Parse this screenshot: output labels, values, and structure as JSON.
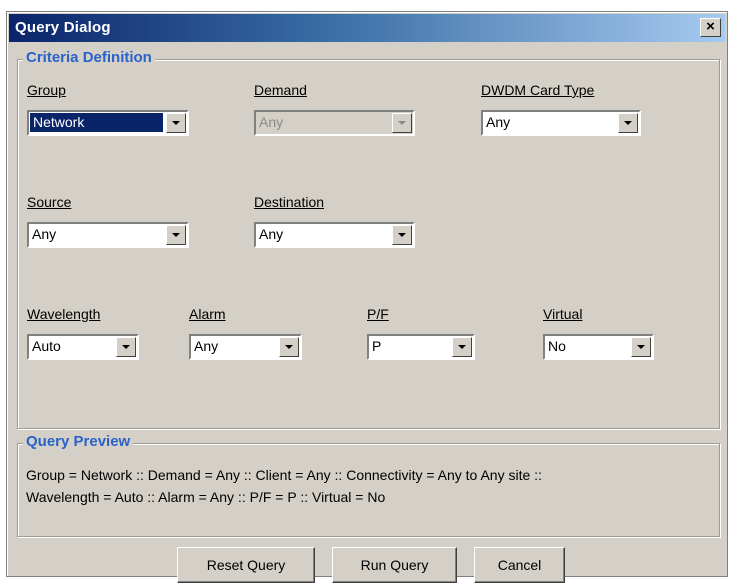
{
  "window": {
    "title": "Query Dialog",
    "close_glyph": "×",
    "close_icon": "close-icon"
  },
  "criteria": {
    "legend": "Criteria Definition",
    "group": {
      "label": "Group",
      "value": "Network"
    },
    "demand": {
      "label": "Demand",
      "value": "Any"
    },
    "dwdm": {
      "label": "DWDM Card Type",
      "value": "Any"
    },
    "source": {
      "label": "Source",
      "value": "Any"
    },
    "destination": {
      "label": "Destination",
      "value": "Any"
    },
    "wavelength": {
      "label": "Wavelength",
      "value": "Auto"
    },
    "alarm": {
      "label": "Alarm",
      "value": "Any"
    },
    "pf": {
      "label": "P/F",
      "value": "P"
    },
    "virtual": {
      "label": "Virtual",
      "value": "No"
    }
  },
  "preview": {
    "legend": "Query Preview",
    "line1": "Group = Network :: Demand = Any :: Client = Any :: Connectivity = Any to Any site ::",
    "line2": "Wavelength = Auto :: Alarm = Any :: P/F = P :: Virtual = No"
  },
  "buttons": {
    "reset": "Reset Query",
    "run": "Run Query",
    "cancel": "Cancel"
  },
  "colors": {
    "title_bar_start": "#0a246a",
    "title_bar_end": "#a6caf0",
    "legend_text": "#2a62c8",
    "dialog_face": "#d4d0c8"
  }
}
